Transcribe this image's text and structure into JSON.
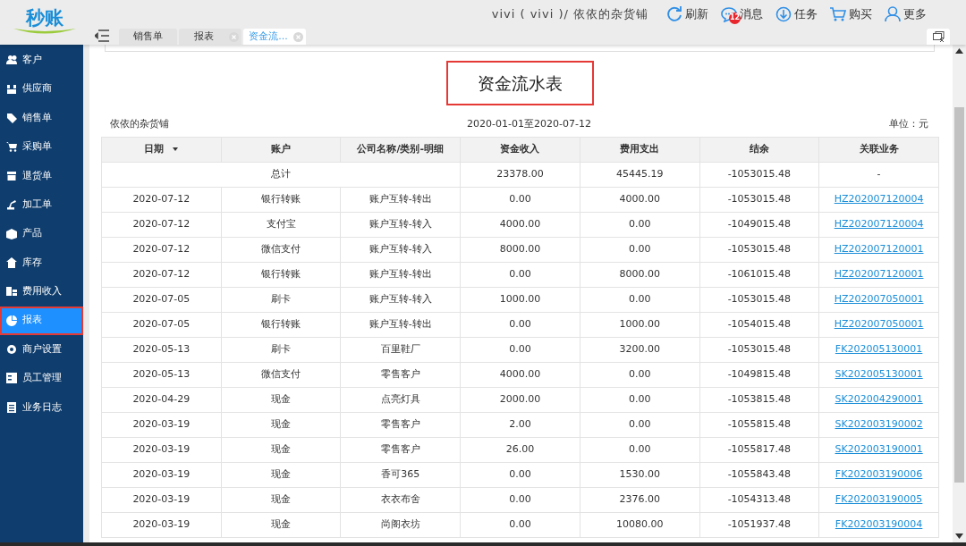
{
  "header": {
    "logo": "秒账",
    "user": "vivi ( vivi )/ 依依的杂货铺",
    "actions": [
      {
        "kind": "refresh",
        "label": "刷新"
      },
      {
        "kind": "message",
        "label": "消息",
        "badge": "12"
      },
      {
        "kind": "task",
        "label": "任务"
      },
      {
        "kind": "buy",
        "label": "购买"
      },
      {
        "kind": "more",
        "label": "更多"
      }
    ]
  },
  "tabs": [
    {
      "label": "销售单",
      "selected": false,
      "closable": false
    },
    {
      "label": "报表",
      "selected": false,
      "closable": true
    },
    {
      "label": "资金流...",
      "selected": true,
      "closable": true
    }
  ],
  "sidebar": {
    "items": [
      {
        "kind": "people",
        "label": "客户",
        "selected": false
      },
      {
        "kind": "supplier",
        "label": "供应商",
        "selected": false
      },
      {
        "kind": "tag",
        "label": "销售单",
        "selected": false
      },
      {
        "kind": "cart",
        "label": "采购单",
        "selected": false
      },
      {
        "kind": "return",
        "label": "退货单",
        "selected": false
      },
      {
        "kind": "machine",
        "label": "加工单",
        "selected": false
      },
      {
        "kind": "box",
        "label": "产品",
        "selected": false
      },
      {
        "kind": "house",
        "label": "库存",
        "selected": false
      },
      {
        "kind": "money",
        "label": "费用收入",
        "selected": false
      },
      {
        "kind": "pie",
        "label": "报表",
        "selected": true
      },
      {
        "kind": "gear",
        "label": "商户设置",
        "selected": false
      },
      {
        "kind": "staff",
        "label": "员工管理",
        "selected": false
      },
      {
        "kind": "list",
        "label": "业务日志",
        "selected": false
      }
    ]
  },
  "report": {
    "title": "资金流水表",
    "shop": "依依的杂货铺",
    "period": "2020-01-01至2020-07-12",
    "unit": "单位：元",
    "columns": [
      {
        "label": "日期",
        "sorted": true
      },
      {
        "label": "账户",
        "sorted": false
      },
      {
        "label": "公司名称/类别-明细",
        "sorted": false
      },
      {
        "label": "资金收入",
        "sorted": false
      },
      {
        "label": "费用支出",
        "sorted": false
      },
      {
        "label": "结余",
        "sorted": false
      },
      {
        "label": "关联业务",
        "sorted": false
      }
    ],
    "total": {
      "label": "总计",
      "income": "23378.00",
      "expense": "45445.19",
      "balance": "-1053015.48",
      "link": "-"
    },
    "rows": [
      [
        "2020-07-12",
        "银行转账",
        "账户互转-转出",
        "0.00",
        "4000.00",
        "-1053015.48",
        "HZ202007120004"
      ],
      [
        "2020-07-12",
        "支付宝",
        "账户互转-转入",
        "4000.00",
        "0.00",
        "-1049015.48",
        "HZ202007120004"
      ],
      [
        "2020-07-12",
        "微信支付",
        "账户互转-转入",
        "8000.00",
        "0.00",
        "-1053015.48",
        "HZ202007120001"
      ],
      [
        "2020-07-12",
        "银行转账",
        "账户互转-转出",
        "0.00",
        "8000.00",
        "-1061015.48",
        "HZ202007120001"
      ],
      [
        "2020-07-05",
        "刷卡",
        "账户互转-转入",
        "1000.00",
        "0.00",
        "-1053015.48",
        "HZ202007050001"
      ],
      [
        "2020-07-05",
        "银行转账",
        "账户互转-转出",
        "0.00",
        "1000.00",
        "-1054015.48",
        "HZ202007050001"
      ],
      [
        "2020-05-13",
        "刷卡",
        "百里鞋厂",
        "0.00",
        "3200.00",
        "-1053015.48",
        "FK202005130001"
      ],
      [
        "2020-05-13",
        "微信支付",
        "零售客户",
        "4000.00",
        "0.00",
        "-1049815.48",
        "SK202005130001"
      ],
      [
        "2020-04-29",
        "现金",
        "点亮灯具",
        "2000.00",
        "0.00",
        "-1053815.48",
        "SK202004290001"
      ],
      [
        "2020-03-19",
        "现金",
        "零售客户",
        "2.00",
        "0.00",
        "-1055815.48",
        "SK202003190002"
      ],
      [
        "2020-03-19",
        "现金",
        "零售客户",
        "26.00",
        "0.00",
        "-1055817.48",
        "SK202003190001"
      ],
      [
        "2020-03-19",
        "现金",
        "香可365",
        "0.00",
        "1530.00",
        "-1055843.48",
        "FK202003190006"
      ],
      [
        "2020-03-19",
        "现金",
        "衣衣布舍",
        "0.00",
        "2376.00",
        "-1054313.48",
        "FK202003190005"
      ],
      [
        "2020-03-19",
        "现金",
        "尚阁衣坊",
        "0.00",
        "10080.00",
        "-1051937.48",
        "FK202003190004"
      ]
    ]
  }
}
